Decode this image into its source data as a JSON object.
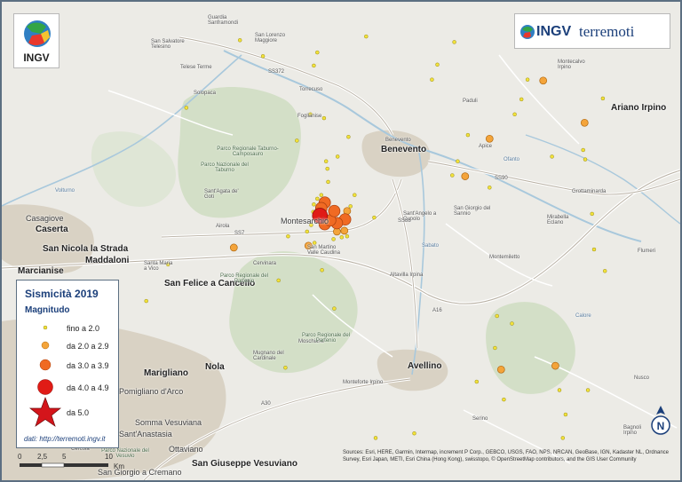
{
  "legend": {
    "title": "Sismicità 2019",
    "subtitle": "Magnitudo",
    "classes": [
      {
        "label": "fino a 2.0",
        "color": "#f2e23a"
      },
      {
        "label": "da 2.0 a 2.9",
        "color": "#f4a43a"
      },
      {
        "label": "da 3.0 a 3.9",
        "color": "#f06a23"
      },
      {
        "label": "da 4.0 a 4.9",
        "color": "#e01b16"
      },
      {
        "label": "da 5.0",
        "color": "#d4151b"
      }
    ],
    "link": "dati: http://terremoti.ingv.it"
  },
  "logos": {
    "ingv_left": "INGV",
    "brand_ingv": "INGV",
    "brand_terremoti": "terremoti"
  },
  "places": {
    "benevento": "Benevento",
    "benevento_small": "Benevento",
    "avellino": "Avellino",
    "ariano": "Ariano Irpino",
    "caserta": "Caserta",
    "casagiove": "Casagiove",
    "san_nicola": "San Nicola la Strada",
    "maddaloni": "Maddaloni",
    "marcianise": "Marcianise",
    "san_felice": "San Felice a Cancello",
    "nola": "Nola",
    "marigliano": "Marigliano",
    "pomigliano": "Pomigliano d'Arco",
    "somma": "Somma Vesuviana",
    "anastasia": "Sant'Anastasia",
    "ottaviano": "Ottaviano",
    "san_giuseppe": "San Giuseppe Vesuviano",
    "san_giorgio_cremano": "San Giorgio a Cremano",
    "cercola": "Cercola",
    "montesarchio": "Montesarchio",
    "san_martino": "San Martino Valle Caudina",
    "sant_agata": "Sant'Agata de' Goti",
    "airola": "Airola",
    "cervinara": "Cervinara",
    "altavilla": "Altavilla Irpina",
    "sant_angelo": "Sant'Angelo a Cupolo",
    "san_giorgio_sannio": "San Giorgio del Sannio",
    "montemiletto": "Montemiletto",
    "mirabella": "Mirabella Eclano",
    "grottaminarda": "Grottaminarda",
    "flumeri": "Flumeri",
    "solopaca": "Solopaca",
    "telese": "Telese Terme",
    "san_salvatore": "San Salvatore Telesino",
    "san_lorenzo": "San Lorenzo Maggiore",
    "guardia": "Guardia Sanframondi",
    "foglianise": "Foglianise",
    "torrecuso": "Torrecuso",
    "paduli": "Paduli",
    "apice": "Apice",
    "montecalvo": "Montecalvo Irpino",
    "nusco": "Nusco",
    "bagnoli": "Bagnoli Irpino",
    "serino": "Serino",
    "mugnano": "Mugnano del Cardinale",
    "santa_maria_vico": "Santa Maria a Vico",
    "moschiano": "Moschiano",
    "monteforte": "Monteforte Irpino",
    "parco_taburno": "Parco Regionale Taburno-Camposauro",
    "parco_taburno_naz": "Parco Nazionale del Taburno",
    "parco_partenio": "Parco Regionale del Partenio",
    "parco_partenio_2": "Parco Regionale del Partenio",
    "parco_monte_picentini": "Parco Nazionale del Vesuvio",
    "ofanto": "Ofanto",
    "calore": "Calore",
    "sabato": "Sabato",
    "volturno": "Volturno"
  },
  "roads": {
    "ss372": "SS372",
    "a16": "A16",
    "ss88": "SS88",
    "ss7": "SS7",
    "ss90": "SS90",
    "a30": "A30"
  },
  "events": [
    {
      "lon": 14.676,
      "lat": 41.076,
      "mag": 3.3
    },
    {
      "lon": 14.671,
      "lat": 41.07,
      "mag": 3.6
    },
    {
      "lon": 14.669,
      "lat": 41.062,
      "mag": 4.0
    },
    {
      "lon": 14.69,
      "lat": 41.067,
      "mag": 3.9
    },
    {
      "lon": 14.684,
      "lat": 41.057,
      "mag": 3.8
    },
    {
      "lon": 14.676,
      "lat": 41.053,
      "mag": 3.7
    },
    {
      "lon": 14.694,
      "lat": 41.054,
      "mag": 3.1
    },
    {
      "lon": 14.706,
      "lat": 41.058,
      "mag": 3.0
    },
    {
      "lon": 14.705,
      "lat": 41.046,
      "mag": 2.6
    },
    {
      "lon": 14.709,
      "lat": 41.067,
      "mag": 2.2
    },
    {
      "lon": 14.694,
      "lat": 41.045,
      "mag": 2.4
    },
    {
      "lon": 14.652,
      "lat": 41.03,
      "mag": 2.3
    },
    {
      "lon": 14.542,
      "lat": 41.028,
      "mag": 2.3
    },
    {
      "lon": 14.883,
      "lat": 41.104,
      "mag": 2.2
    },
    {
      "lon": 14.919,
      "lat": 41.144,
      "mag": 2.3
    },
    {
      "lon": 14.998,
      "lat": 41.206,
      "mag": 2.2
    },
    {
      "lon": 15.059,
      "lat": 41.161,
      "mag": 2.4
    },
    {
      "lon": 14.936,
      "lat": 40.898,
      "mag": 2.2
    },
    {
      "lon": 15.016,
      "lat": 40.902,
      "mag": 2.3
    },
    {
      "lon": 14.671,
      "lat": 41.084,
      "mag": 1.5
    },
    {
      "lon": 14.665,
      "lat": 41.08,
      "mag": 1.2
    },
    {
      "lon": 14.66,
      "lat": 41.074,
      "mag": 1.3
    },
    {
      "lon": 14.659,
      "lat": 41.066,
      "mag": 1.0
    },
    {
      "lon": 14.714,
      "lat": 41.072,
      "mag": 1.4
    },
    {
      "lon": 14.701,
      "lat": 41.039,
      "mag": 1.1
    },
    {
      "lon": 14.709,
      "lat": 41.04,
      "mag": 1.6
    },
    {
      "lon": 14.689,
      "lat": 41.037,
      "mag": 1.0
    },
    {
      "lon": 14.681,
      "lat": 41.098,
      "mag": 1.2
    },
    {
      "lon": 14.68,
      "lat": 41.112,
      "mag": 1.4
    },
    {
      "lon": 14.695,
      "lat": 41.125,
      "mag": 1.1
    },
    {
      "lon": 14.711,
      "lat": 41.146,
      "mag": 1.0
    },
    {
      "lon": 14.72,
      "lat": 41.084,
      "mag": 1.3
    },
    {
      "lon": 14.65,
      "lat": 41.045,
      "mag": 1.5
    },
    {
      "lon": 14.656,
      "lat": 41.052,
      "mag": 1.2
    },
    {
      "lon": 14.661,
      "lat": 41.033,
      "mag": 1.1
    },
    {
      "lon": 14.678,
      "lat": 41.12,
      "mag": 1.3
    },
    {
      "lon": 14.675,
      "lat": 41.166,
      "mag": 1.1
    },
    {
      "lon": 14.665,
      "lat": 41.236,
      "mag": 1.2
    },
    {
      "lon": 14.66,
      "lat": 41.222,
      "mag": 1.0
    },
    {
      "lon": 14.655,
      "lat": 41.17,
      "mag": 1.4
    },
    {
      "lon": 14.635,
      "lat": 41.142,
      "mag": 1.2
    },
    {
      "lon": 14.622,
      "lat": 41.04,
      "mag": 1.1
    },
    {
      "lon": 14.672,
      "lat": 41.004,
      "mag": 1.0
    },
    {
      "lon": 14.608,
      "lat": 40.993,
      "mag": 1.1
    },
    {
      "lon": 14.69,
      "lat": 40.963,
      "mag": 1.2
    },
    {
      "lon": 14.749,
      "lat": 41.06,
      "mag": 1.0
    },
    {
      "lon": 14.887,
      "lat": 41.148,
      "mag": 1.1
    },
    {
      "lon": 14.872,
      "lat": 41.12,
      "mag": 1.3
    },
    {
      "lon": 14.864,
      "lat": 41.105,
      "mag": 1.0
    },
    {
      "lon": 14.919,
      "lat": 41.092,
      "mag": 1.2
    },
    {
      "lon": 14.956,
      "lat": 41.17,
      "mag": 1.1
    },
    {
      "lon": 14.966,
      "lat": 41.186,
      "mag": 1.0
    },
    {
      "lon": 14.975,
      "lat": 41.207,
      "mag": 1.3
    },
    {
      "lon": 14.867,
      "lat": 41.247,
      "mag": 1.2
    },
    {
      "lon": 14.834,
      "lat": 41.207,
      "mag": 1.0
    },
    {
      "lon": 14.842,
      "lat": 41.223,
      "mag": 1.1
    },
    {
      "lon": 15.011,
      "lat": 41.125,
      "mag": 1.0
    },
    {
      "lon": 15.06,
      "lat": 41.122,
      "mag": 1.2
    },
    {
      "lon": 15.086,
      "lat": 41.187,
      "mag": 1.1
    },
    {
      "lon": 15.057,
      "lat": 41.132,
      "mag": 1.0
    },
    {
      "lon": 15.073,
      "lat": 41.026,
      "mag": 1.3
    },
    {
      "lon": 15.07,
      "lat": 41.064,
      "mag": 1.1
    },
    {
      "lon": 15.089,
      "lat": 41.003,
      "mag": 1.0
    },
    {
      "lon": 15.064,
      "lat": 40.876,
      "mag": 1.2
    },
    {
      "lon": 15.031,
      "lat": 40.85,
      "mag": 1.1
    },
    {
      "lon": 14.94,
      "lat": 40.866,
      "mag": 1.0
    },
    {
      "lon": 14.927,
      "lat": 40.921,
      "mag": 1.2
    },
    {
      "lon": 14.9,
      "lat": 40.885,
      "mag": 1.3
    },
    {
      "lon": 14.808,
      "lat": 40.83,
      "mag": 1.1
    },
    {
      "lon": 14.751,
      "lat": 40.825,
      "mag": 1.0
    },
    {
      "lon": 14.618,
      "lat": 40.9,
      "mag": 1.1
    },
    {
      "lon": 14.445,
      "lat": 41.01,
      "mag": 1.2
    },
    {
      "lon": 14.413,
      "lat": 40.971,
      "mag": 1.0
    },
    {
      "lon": 14.472,
      "lat": 41.177,
      "mag": 1.1
    },
    {
      "lon": 14.551,
      "lat": 41.249,
      "mag": 1.0
    },
    {
      "lon": 14.585,
      "lat": 41.232,
      "mag": 1.2
    },
    {
      "lon": 14.737,
      "lat": 41.253,
      "mag": 1.1
    },
    {
      "lon": 14.952,
      "lat": 40.947,
      "mag": 1.0
    },
    {
      "lon": 14.93,
      "lat": 40.955,
      "mag": 1.1
    },
    {
      "lon": 15.027,
      "lat": 40.825,
      "mag": 1.2
    },
    {
      "lon": 15.022,
      "lat": 40.876,
      "mag": 1.0
    }
  ]
}
